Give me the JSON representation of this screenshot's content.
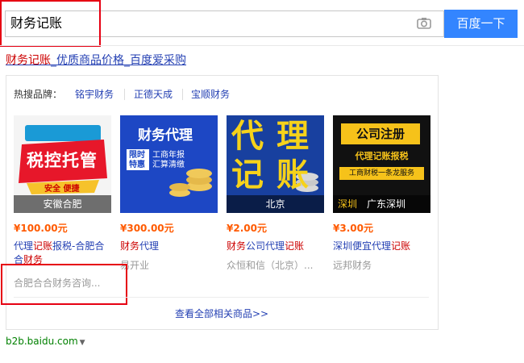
{
  "search": {
    "query": "财务记账",
    "button_label": "百度一下"
  },
  "result": {
    "title_em": "财务记账",
    "title_rest": "_优质商品价格_百度爱采购",
    "hot_label": "热搜品牌：",
    "brands": [
      "铭宇财务",
      "正德天成",
      "宝顺财务"
    ],
    "products": [
      {
        "image_caption": "安徽合肥",
        "image_text": "税控托管",
        "image_badge": "安全 便捷",
        "price": "¥100.00元",
        "title_line1_pre": "代理",
        "title_line1_em": "记账",
        "title_line1_post": "报税-合肥合",
        "title_line2_pre": "合",
        "title_line2_em": "财务",
        "title_line2_post": ""
      },
      {
        "image_caption": "",
        "image_text": "财务代理",
        "image_sub": [
          "限时",
          "特惠"
        ],
        "image_sub2": [
          "工商年报",
          "汇算清缴"
        ],
        "price": "¥300.00元",
        "title_line1_pre": "",
        "title_line1_em": "财务",
        "title_line1_post": "代理",
        "shop": "易开业"
      },
      {
        "image_caption": "北京",
        "image_text_top": "代理",
        "image_text_bottom": "记账",
        "price": "¥2.00元",
        "title_line1_pre": "",
        "title_line1_em": "财务",
        "title_line1_post": "公司代理",
        "title_line1_em2": "记账",
        "shop": "众恒和信（北京）..."
      },
      {
        "image_caption": "广东深圳",
        "image_caption_left": "深圳",
        "image_text": "公司注册",
        "image_sub": "代理记账报税",
        "image_band": "工商财税一条龙服务",
        "price": "¥3.00元",
        "title_line1_pre": "深圳便宜代理",
        "title_line1_em": "记账",
        "title_line1_post": "",
        "shop": "远邦财务"
      }
    ],
    "first_shop": "合肥合合财务咨询...",
    "view_all": "查看全部相关商品>>",
    "source": "b2b.baidu.com"
  },
  "colors": {
    "accent": "#3385ff",
    "link": "#2440b3",
    "emphasis": "#cc0000",
    "price": "#ff5a00",
    "highlight_box": "#e60012"
  }
}
